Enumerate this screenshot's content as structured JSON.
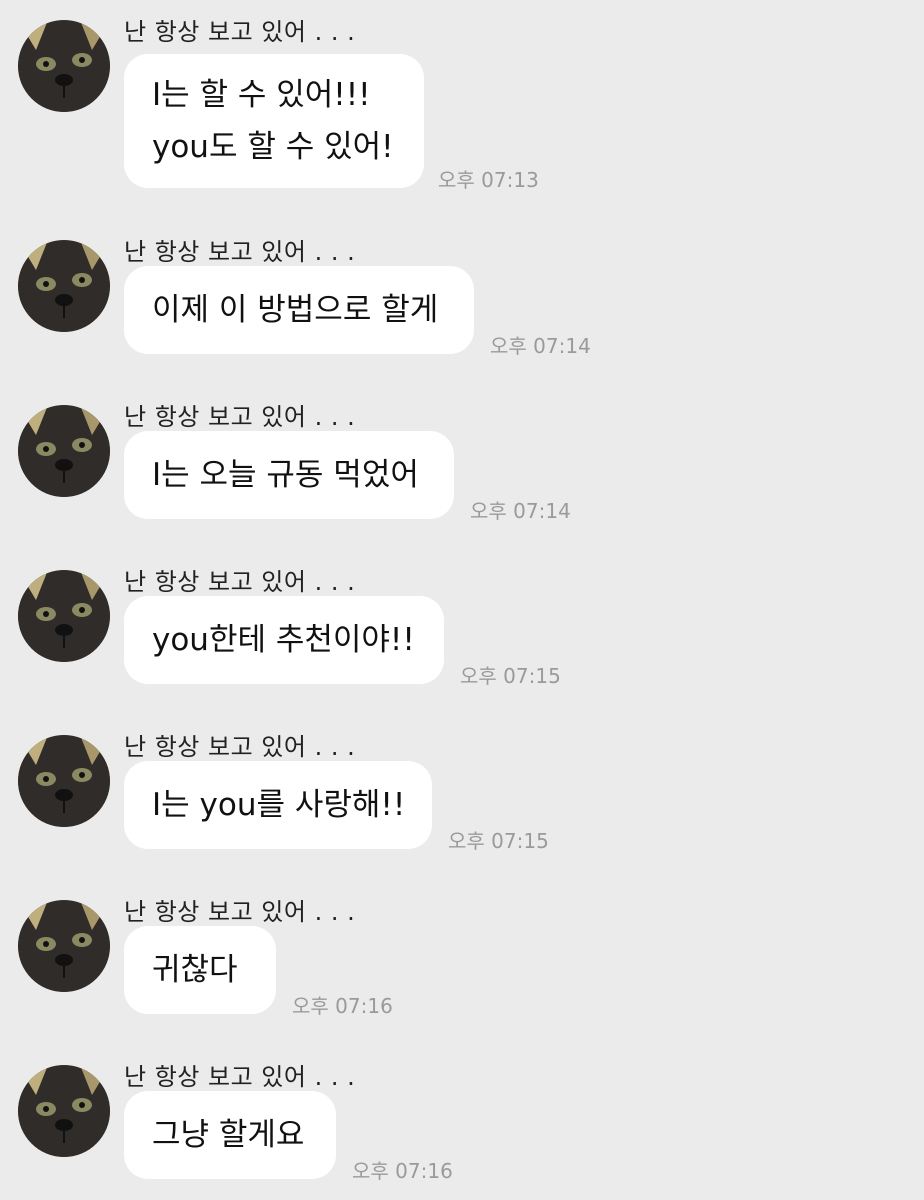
{
  "colors": {
    "background": "#ebebeb",
    "bubble": "#ffffff",
    "time_text": "#9a9a9a"
  },
  "messages": [
    {
      "sender": "난 항상 보고 있어 . . .",
      "lines": [
        "I는 할 수 있어!!!",
        "you도 할 수 있어!"
      ],
      "time": "오후 07:13",
      "avatar_icon": "cat-face-icon"
    },
    {
      "sender": "난 항상 보고 있어 . . .",
      "lines": [
        "이제 이 방법으로 할게"
      ],
      "time": "오후 07:14",
      "avatar_icon": "cat-face-icon"
    },
    {
      "sender": "난 항상 보고 있어 . . .",
      "lines": [
        "I는 오늘 규동 먹었어"
      ],
      "time": "오후 07:14",
      "avatar_icon": "cat-face-icon"
    },
    {
      "sender": "난 항상 보고 있어 . . .",
      "lines": [
        "you한테 추천이야!!"
      ],
      "time": "오후 07:15",
      "avatar_icon": "cat-face-icon"
    },
    {
      "sender": "난 항상 보고 있어 . . .",
      "lines": [
        "I는 you를 사랑해!!"
      ],
      "time": "오후 07:15",
      "avatar_icon": "cat-face-icon"
    },
    {
      "sender": "난 항상 보고 있어 . . .",
      "lines": [
        "귀찮다"
      ],
      "time": "오후 07:16",
      "avatar_icon": "cat-face-icon"
    },
    {
      "sender": "난 항상 보고 있어 . . .",
      "lines": [
        "그냥 할게요"
      ],
      "time": "오후 07:16",
      "avatar_icon": "cat-face-icon"
    }
  ]
}
